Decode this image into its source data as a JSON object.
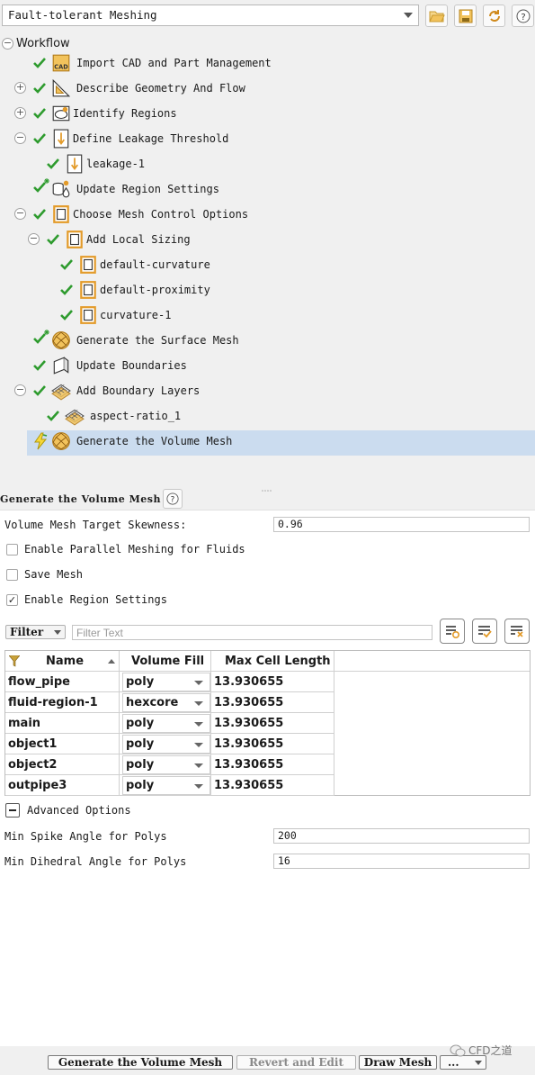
{
  "topbar": {
    "workflow_select": "Fault-tolerant Meshing",
    "buttons": [
      "open-folder-icon",
      "save-icon",
      "refresh-icon",
      "help-icon"
    ]
  },
  "tree": {
    "root_label": "Workflow",
    "items": [
      {
        "label": "Import CAD and Part Management",
        "icon": "cad-icon"
      },
      {
        "label": "Describe Geometry And Flow",
        "icon": "triangle-ruler-icon"
      },
      {
        "label": "Identify Regions",
        "icon": "region-icon"
      },
      {
        "label": "Define Leakage Threshold",
        "icon": "leakage-icon"
      },
      {
        "label": "leakage-1",
        "icon": "leakage-icon"
      },
      {
        "label": "Update Region Settings",
        "icon": "region-settings-icon"
      },
      {
        "label": "Choose Mesh Control Options",
        "icon": "mesh-control-icon"
      },
      {
        "label": "Add Local Sizing",
        "icon": "mesh-control-icon"
      },
      {
        "label": "default-curvature",
        "icon": "mesh-control-icon"
      },
      {
        "label": "default-proximity",
        "icon": "mesh-control-icon"
      },
      {
        "label": "curvature-1",
        "icon": "mesh-control-icon"
      },
      {
        "label": "Generate the Surface Mesh",
        "icon": "surface-mesh-icon"
      },
      {
        "label": "Update Boundaries",
        "icon": "boundaries-icon"
      },
      {
        "label": "Add Boundary Layers",
        "icon": "boundary-layers-icon"
      },
      {
        "label": "aspect-ratio_1",
        "icon": "boundary-layers-icon"
      },
      {
        "label": "Generate the Volume Mesh",
        "icon": "volume-mesh-icon"
      }
    ]
  },
  "panel": {
    "title": "Generate the Volume Mesh",
    "skewness_label": "Volume Mesh Target Skewness:",
    "skewness_value": "0.96",
    "parallel_label": "Enable Parallel Meshing for Fluids",
    "save_mesh_label": "Save Mesh",
    "region_settings_label": "Enable Region Settings",
    "filter_label": "Filter",
    "filter_placeholder": "Filter Text",
    "columns": [
      "Name",
      "Volume Fill",
      "Max Cell Length"
    ],
    "rows": [
      {
        "name": "flow_pipe",
        "fill": "poly",
        "length": "13.930655"
      },
      {
        "name": "fluid-region-1",
        "fill": "hexcore",
        "length": "13.930655"
      },
      {
        "name": "main",
        "fill": "poly",
        "length": "13.930655"
      },
      {
        "name": "object1",
        "fill": "poly",
        "length": "13.930655"
      },
      {
        "name": "object2",
        "fill": "poly",
        "length": "13.930655"
      },
      {
        "name": "outpipe3",
        "fill": "poly",
        "length": "13.930655"
      }
    ],
    "advanced_label": "Advanced Options",
    "spike_label": "Min Spike Angle for Polys",
    "spike_value": "200",
    "dihedral_label": "Min Dihedral Angle for Polys",
    "dihedral_value": "16"
  },
  "bottom": {
    "generate_label": "Generate the Volume Mesh",
    "revert_label": "Revert and Edit",
    "draw_label": "Draw Mesh",
    "more_label": "...",
    "watermark": "CFD之道"
  },
  "colors": {
    "check_green": "#2e9b2e",
    "selected_row": "#cbdcef",
    "icon_orange": "#e39b2a"
  }
}
